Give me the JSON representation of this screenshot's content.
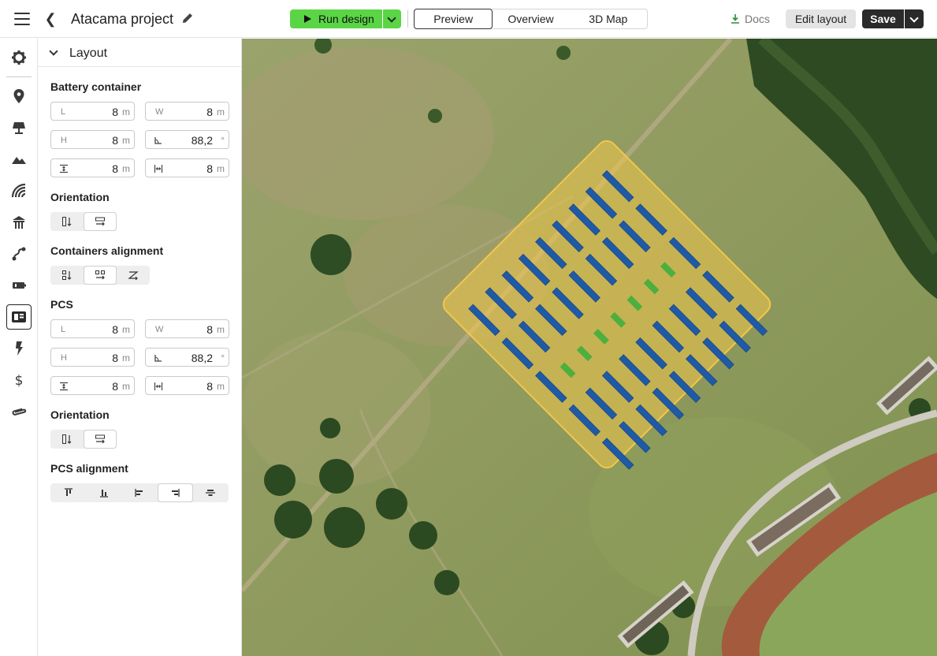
{
  "header": {
    "project_title": "Atacama project",
    "run_label": "Run design",
    "tabs": [
      {
        "label": "Preview",
        "active": true
      },
      {
        "label": "Overview",
        "active": false
      },
      {
        "label": "3D Map",
        "active": false
      }
    ],
    "docs_label": "Docs",
    "edit_layout_label": "Edit layout",
    "save_label": "Save",
    "run_color": "#5ad545"
  },
  "rail": {
    "items": [
      {
        "icon": "gear-icon"
      },
      {
        "icon": "location-pin-icon"
      },
      {
        "icon": "solar-panel-icon"
      },
      {
        "icon": "terrain-icon"
      },
      {
        "icon": "contour-layers-icon"
      },
      {
        "icon": "structure-icon"
      },
      {
        "icon": "cable-route-icon"
      },
      {
        "icon": "battery-icon"
      },
      {
        "icon": "layout-icon",
        "active": true
      },
      {
        "icon": "lightning-icon"
      },
      {
        "icon": "dollar-icon"
      },
      {
        "icon": "paperclip-icon"
      }
    ]
  },
  "panel": {
    "title": "Layout",
    "battery": {
      "title": "Battery container",
      "L": {
        "label": "L",
        "value": "8",
        "unit": "m"
      },
      "W": {
        "label": "W",
        "value": "8",
        "unit": "m"
      },
      "H": {
        "label": "H",
        "value": "8",
        "unit": "m"
      },
      "angle": {
        "value": "88,2",
        "unit": "°"
      },
      "spacing_v": {
        "value": "8",
        "unit": "m"
      },
      "spacing_h": {
        "value": "8",
        "unit": "m"
      }
    },
    "battery_orientation": {
      "title": "Orientation",
      "selected": 1
    },
    "containers_alignment": {
      "title": "Containers alignment",
      "selected": 1
    },
    "pcs": {
      "title": "PCS",
      "L": {
        "label": "L",
        "value": "8",
        "unit": "m"
      },
      "W": {
        "label": "W",
        "value": "8",
        "unit": "m"
      },
      "H": {
        "label": "H",
        "value": "8",
        "unit": "m"
      },
      "angle": {
        "value": "88,2",
        "unit": "°"
      },
      "spacing_v": {
        "value": "8",
        "unit": "m"
      },
      "spacing_h": {
        "value": "8",
        "unit": "m"
      }
    },
    "pcs_orientation": {
      "title": "Orientation",
      "selected": 1
    },
    "pcs_alignment": {
      "title": "PCS alignment",
      "selected": 3
    }
  },
  "map": {
    "site_color": "#f3c64a",
    "battery_color": "#1f5aa6",
    "pcs_color": "#4caf3e"
  }
}
